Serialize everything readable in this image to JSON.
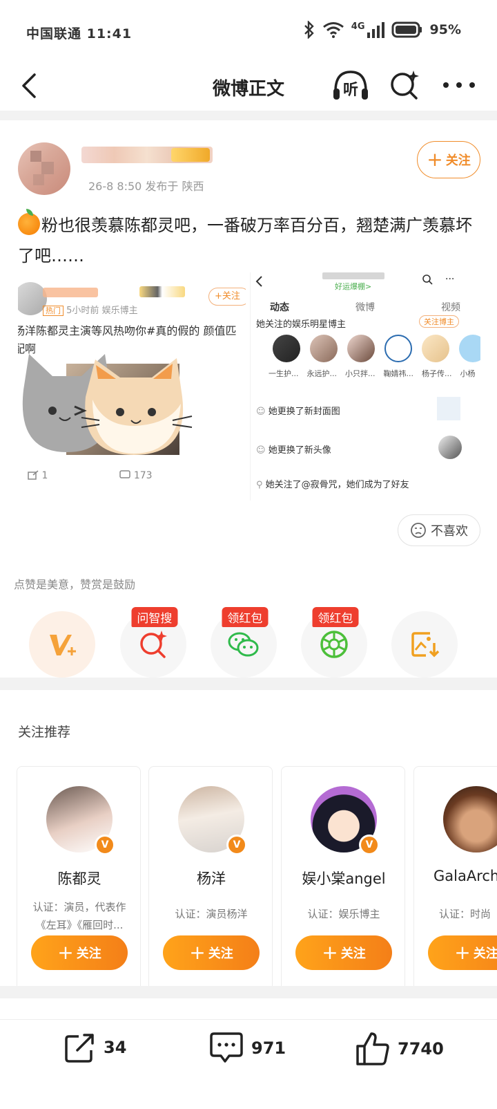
{
  "status_bar": {
    "carrier_time": "中国联通 11:41",
    "network": "4G",
    "battery": "95%"
  },
  "nav": {
    "title": "微博正文",
    "listen_label": "听"
  },
  "post": {
    "meta": "26-8  8:50  发布于 陕西",
    "follow_label": "关注",
    "text": "粉也很羡慕陈都灵吧，一番破万率百分百，翘楚满广羡慕坏了吧……",
    "dislike_label": "不喜欢"
  },
  "screenshot_left": {
    "tag": "热门",
    "time": "5小时前",
    "source": "娱乐博主",
    "follow": "+关注",
    "body": "杨洋陈都灵主演等风热吻你#真的假的 颜值匹配啊",
    "repost_count": "1",
    "comment_count": "173"
  },
  "screenshot_right": {
    "sub_label": "好运爆棚>",
    "tabs": [
      "动态",
      "微博",
      "视频"
    ],
    "follow_line": "她关注的娱乐明星博主",
    "follow_button": "关注博主",
    "avatar_names": [
      "一生护...",
      "永远护...",
      "小只拌...",
      "鞠婧祎...",
      "杨子传...",
      "小杨"
    ],
    "events": [
      "她更换了新封面图",
      "她更换了新头像",
      "她关注了@寂骨咒，她们成为了好友"
    ]
  },
  "hint": "点赞是美意，赞赏是鼓励",
  "actions": [
    {
      "name": "v-plus-icon",
      "badge": ""
    },
    {
      "name": "ai-search-icon",
      "badge": "问智搜"
    },
    {
      "name": "wechat-icon",
      "badge": "领红包"
    },
    {
      "name": "moments-icon",
      "badge": "领红包"
    },
    {
      "name": "save-image-icon",
      "badge": ""
    }
  ],
  "recommend": {
    "title": "关注推荐",
    "follow_label": "关注",
    "cards": [
      {
        "name": "陈都灵",
        "cert": "认证：演员，代表作《左耳》《雁回时..."
      },
      {
        "name": "杨洋",
        "cert": "认证：演员杨洋"
      },
      {
        "name": "娱小棠angel",
        "cert": "认证：娱乐博主"
      },
      {
        "name": "GalaArch",
        "cert": "认证：时尚"
      }
    ]
  },
  "bottom_bar": {
    "repost": "34",
    "comment": "971",
    "like": "7740"
  },
  "colors": {
    "accent": "#f28a1a",
    "badge_red": "#ee3e2e"
  }
}
